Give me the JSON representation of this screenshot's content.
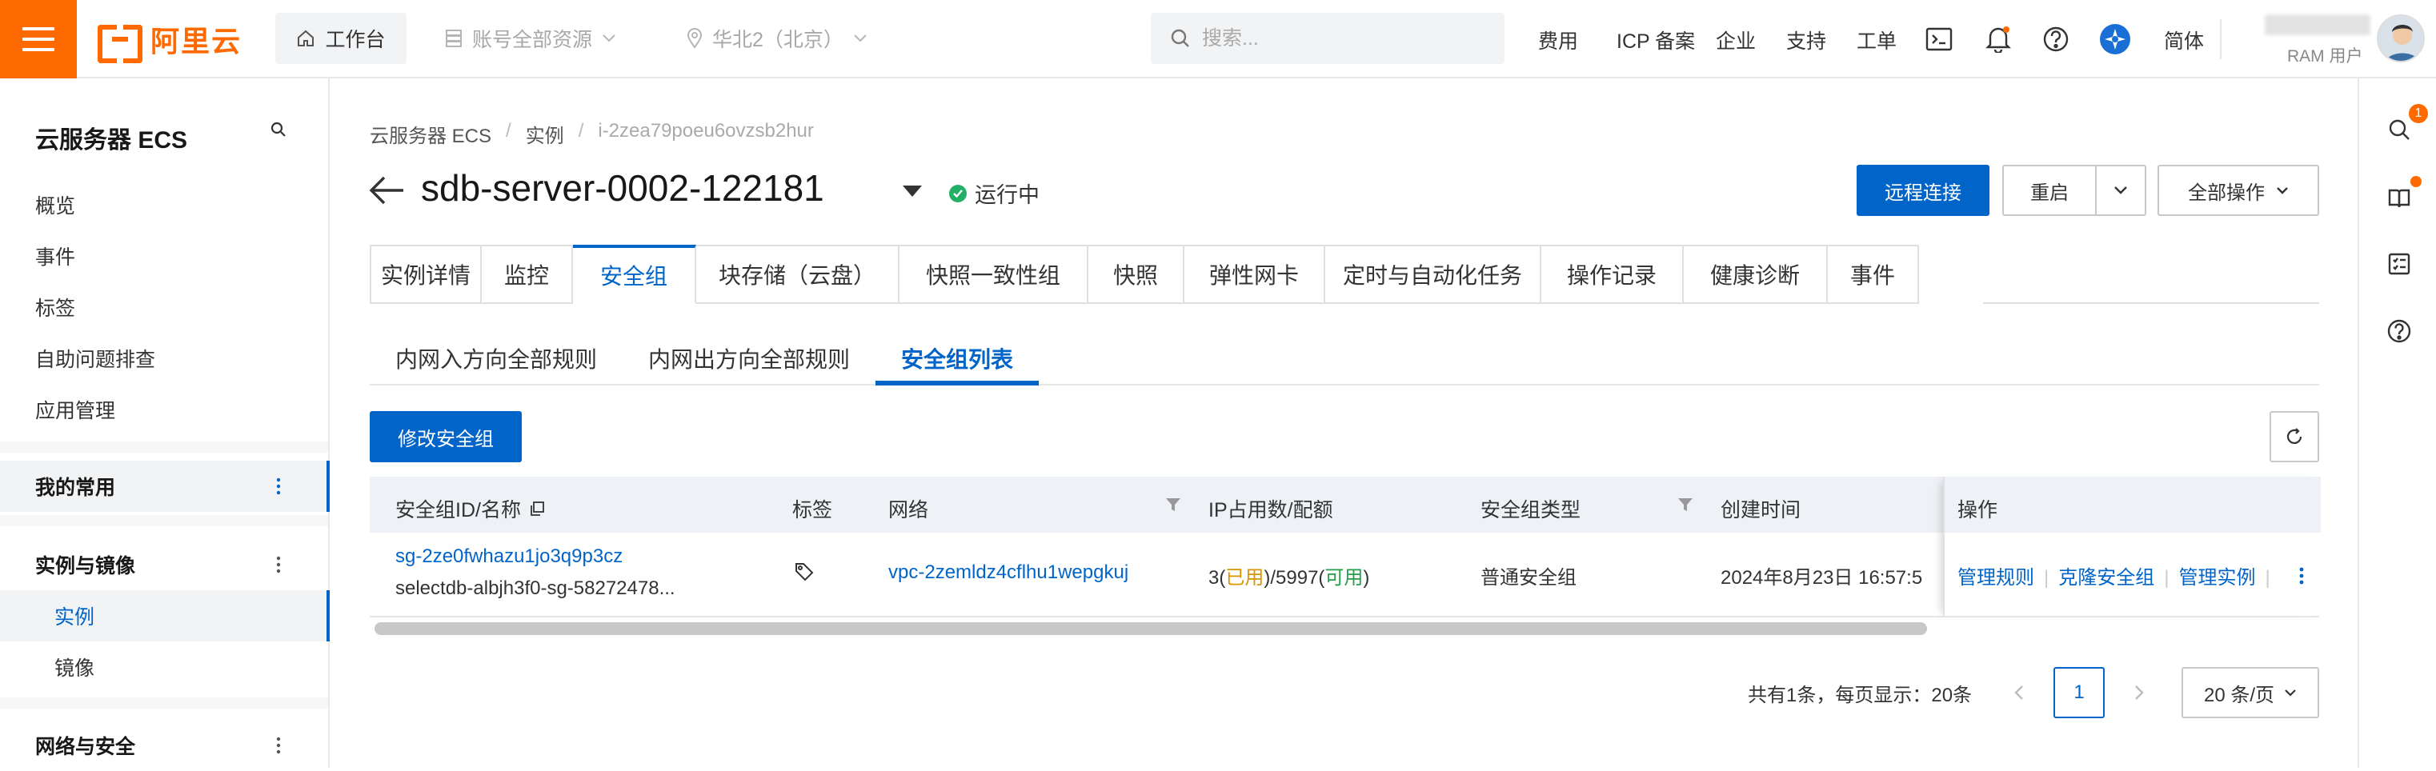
{
  "topbar": {
    "brand": "阿里云",
    "workbench": "工作台",
    "resources": "账号全部资源",
    "region": "华北2（北京）",
    "search_placeholder": "搜索...",
    "nav": [
      "费用",
      "ICP 备案",
      "企业",
      "支持",
      "工单"
    ],
    "lang": "简体",
    "user_role": "RAM 用户"
  },
  "sidebar": {
    "title": "云服务器 ECS",
    "items": [
      "概览",
      "事件",
      "标签",
      "自助问题排查",
      "应用管理"
    ],
    "groups": {
      "favorites": "我的常用",
      "instances_images": "实例与镜像",
      "network_security": "网络与安全"
    },
    "sub_items": [
      "实例",
      "镜像"
    ]
  },
  "rail": {
    "badge": "1"
  },
  "breadcrumb": [
    "云服务器 ECS",
    "实例",
    "i-2zea79poeu6ovzsb2hur"
  ],
  "header": {
    "title": "sdb-server-0002-122181",
    "status": "运行中",
    "remote_connect": "远程连接",
    "restart": "重启",
    "all_actions": "全部操作"
  },
  "tabs": [
    "实例详情",
    "监控",
    "安全组",
    "块存储（云盘）",
    "快照一致性组",
    "快照",
    "弹性网卡",
    "定时与自动化任务",
    "操作记录",
    "健康诊断",
    "事件"
  ],
  "subtabs": [
    "内网入方向全部规则",
    "内网出方向全部规则",
    "安全组列表"
  ],
  "actions": {
    "modify_sg": "修改安全组"
  },
  "table": {
    "headers": {
      "id_name": "安全组ID/名称",
      "tags": "标签",
      "network": "网络",
      "ip_quota": "IP占用数/配额",
      "sg_type": "安全组类型",
      "created": "创建时间",
      "ops": "操作"
    },
    "row": {
      "sg_id": "sg-2ze0fwhazu1jo3q9p3cz",
      "sg_name": "selectdb-albjh3f0-sg-58272478...",
      "vpc": "vpc-2zemldz4cflhu1wepgkuj",
      "ip_used_num": "3",
      "ip_used_label": "已用",
      "ip_avail_num": "5997",
      "ip_avail_label": "可用",
      "sg_type": "普通安全组",
      "created": "2024年8月23日 16:57:5",
      "op_manage_rules": "管理规则",
      "op_clone": "克隆安全组",
      "op_manage_instances": "管理实例"
    }
  },
  "pagination": {
    "summary": "共有1条，每页显示：20条",
    "current": "1",
    "page_size": "20 条/页"
  }
}
